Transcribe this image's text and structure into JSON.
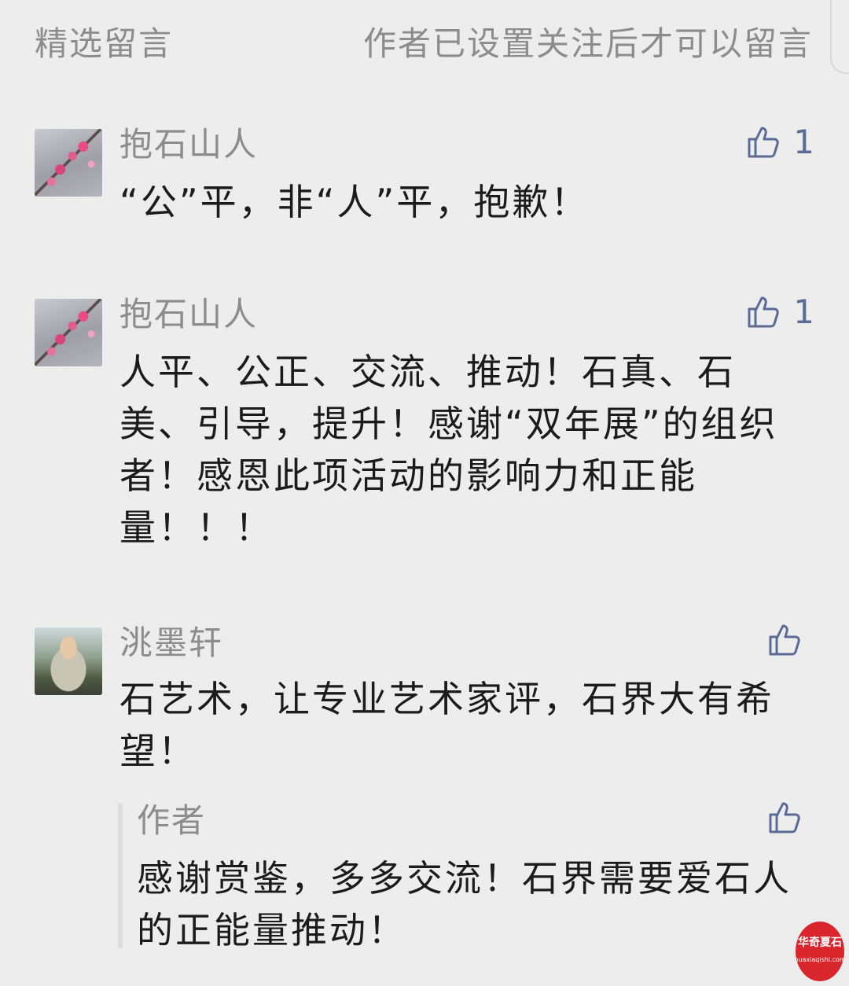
{
  "header": {
    "title": "精选留言",
    "notice": "作者已设置关注后才可以留言"
  },
  "comments": [
    {
      "name": "抱石山人",
      "text": "“公”平，非“人”平，抱歉！",
      "likes": "1",
      "avatar": "plum-blossom-avatar"
    },
    {
      "name": "抱石山人",
      "text": "人平、公正、交流、推动！石真、石美、引导，提升！感谢“双年展”的组织者！感恩此项活动的影响力和正能量！！！",
      "likes": "1",
      "avatar": "plum-blossom-avatar"
    },
    {
      "name": "洮墨轩",
      "text": "石艺术，让专业艺术家评，石界大有希望！",
      "likes": "",
      "avatar": "person-avatar",
      "reply": {
        "name": "作者",
        "text": "感谢赏鉴，多多交流！石界需要爱石人的正能量推动！",
        "likes": ""
      }
    }
  ],
  "watermark": {
    "text": "华奇夏石",
    "url": "huaxiaqishi.com"
  },
  "colors": {
    "background": "#ededed",
    "name_gray": "#8c8c8c",
    "like_blue": "#5b6b95",
    "watermark_red": "#d9262c"
  }
}
